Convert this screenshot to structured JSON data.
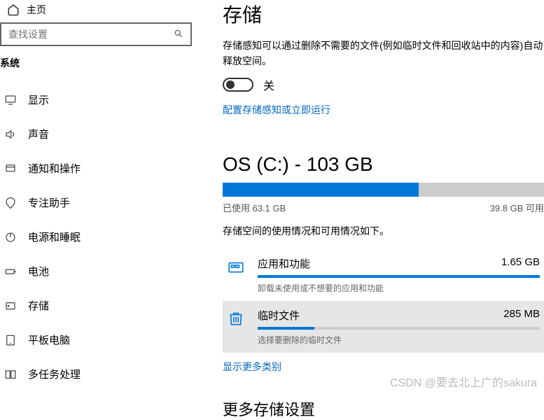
{
  "sidebar": {
    "home": "主页",
    "search_placeholder": "查找设置",
    "section": "系统",
    "items": [
      {
        "label": "显示"
      },
      {
        "label": "声音"
      },
      {
        "label": "通知和操作"
      },
      {
        "label": "专注助手"
      },
      {
        "label": "电源和睡眠"
      },
      {
        "label": "电池"
      },
      {
        "label": "存储"
      },
      {
        "label": "平板电脑"
      },
      {
        "label": "多任务处理"
      }
    ]
  },
  "main": {
    "title": "存储",
    "sense_desc": "存储感知可以通过删除不需要的文件(例如临时文件和回收站中的内容)自动释放空间。",
    "toggle_state": "关",
    "configure_link": "配置存储感知或立即运行",
    "drive_heading": "OS (C:) - 103 GB",
    "used_label": "已使用 63.1 GB",
    "free_label": "39.8 GB 可用",
    "used_percent": 61,
    "usage_desc": "存储空间的使用情况和可用情况如下。",
    "categories": [
      {
        "name": "应用和功能",
        "size": "1.65 GB",
        "sub": "卸载未使用或不想要的应用和功能",
        "fill": 100,
        "selected": false
      },
      {
        "name": "临时文件",
        "size": "285 MB",
        "sub": "选择要删除的临时文件",
        "fill": 20,
        "selected": true
      }
    ],
    "show_more": "显示更多类别",
    "more_heading": "更多存储设置"
  },
  "watermark": "CSDN @要去北上广的sakura"
}
